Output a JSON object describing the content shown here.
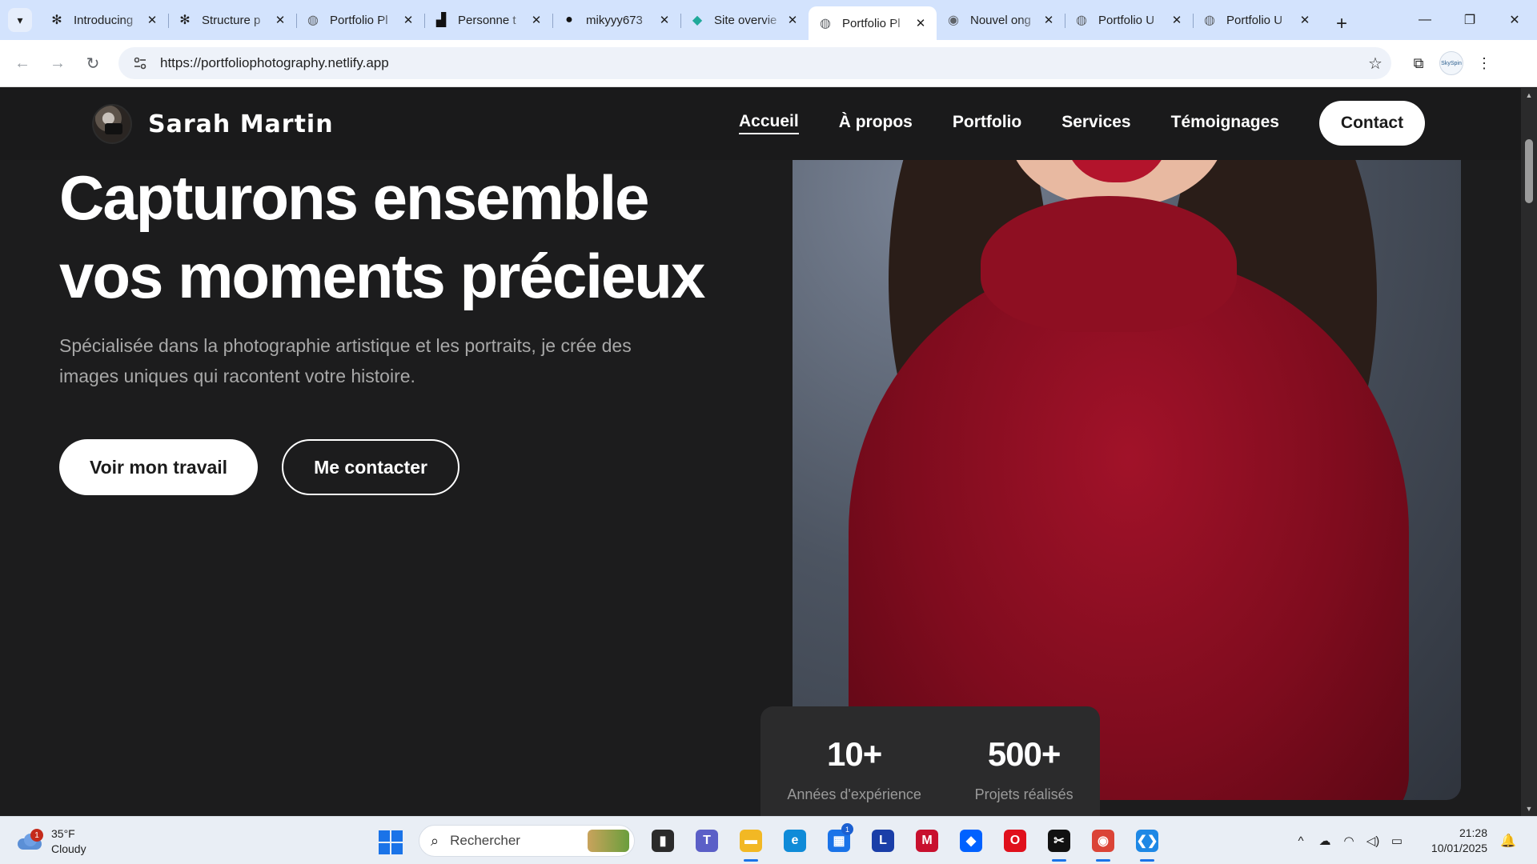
{
  "browser": {
    "tabs": [
      {
        "title": "Introducing",
        "favicon": "openai-icon",
        "active": false
      },
      {
        "title": "Structure p",
        "favicon": "openai-icon",
        "active": false
      },
      {
        "title": "Portfolio Pl",
        "favicon": "globe-icon",
        "active": false
      },
      {
        "title": "Personne t",
        "favicon": "unsplash-icon",
        "active": false
      },
      {
        "title": "mikyyy673",
        "favicon": "github-icon",
        "active": false
      },
      {
        "title": "Site overvie",
        "favicon": "netlify-icon",
        "active": false
      },
      {
        "title": "Portfolio Pl",
        "favicon": "globe-icon",
        "active": true
      },
      {
        "title": "Nouvel ong",
        "favicon": "chrome-icon",
        "active": false
      },
      {
        "title": "Portfolio U",
        "favicon": "globe-icon",
        "active": false
      },
      {
        "title": "Portfolio U",
        "favicon": "globe-icon",
        "active": false
      }
    ],
    "url": "https://portfoliophotography.netlify.app",
    "profile_label": "SkySpin"
  },
  "site": {
    "brand": "Sarah Martin",
    "nav": [
      "Accueil",
      "À propos",
      "Portfolio",
      "Services",
      "Témoignages"
    ],
    "nav_active": "Accueil",
    "contact_label": "Contact",
    "hero": {
      "title": "Capturons ensemble vos moments précieux",
      "subtitle": "Spécialisée dans la photographie artistique et les portraits, je crée des images uniques qui racontent votre histoire.",
      "primary_button": "Voir mon travail",
      "secondary_button": "Me contacter"
    },
    "stats": [
      {
        "value": "10+",
        "label": "Années d'expérience"
      },
      {
        "value": "500+",
        "label": "Projets réalisés"
      }
    ]
  },
  "taskbar": {
    "weather": {
      "temp": "35°F",
      "condition": "Cloudy",
      "badge": "1"
    },
    "search_placeholder": "Rechercher",
    "apps": [
      {
        "name": "task-view",
        "color": "#2b2b2b",
        "glyph": "▮",
        "running": false
      },
      {
        "name": "teams",
        "color": "#5b5fc7",
        "glyph": "T",
        "running": false
      },
      {
        "name": "file-explorer",
        "color": "#f2b824",
        "glyph": "▬",
        "running": true
      },
      {
        "name": "edge",
        "color": "#0f8bd8",
        "glyph": "e",
        "running": false
      },
      {
        "name": "microsoft-store",
        "color": "#1a73e8",
        "glyph": "▦",
        "running": false,
        "badge": "1"
      },
      {
        "name": "l-app",
        "color": "#1a3ea8",
        "glyph": "L",
        "running": false
      },
      {
        "name": "mcafee",
        "color": "#c8102e",
        "glyph": "M",
        "running": false
      },
      {
        "name": "dropbox",
        "color": "#0061ff",
        "glyph": "◆",
        "running": false
      },
      {
        "name": "opera",
        "color": "#e0101c",
        "glyph": "O",
        "running": false
      },
      {
        "name": "capcut",
        "color": "#111111",
        "glyph": "✂",
        "running": true
      },
      {
        "name": "chrome",
        "color": "#db4437",
        "glyph": "◉",
        "running": true
      },
      {
        "name": "vscode",
        "color": "#1e88e5",
        "glyph": "❮❯",
        "running": true
      }
    ],
    "time": "21:28",
    "date": "10/01/2025"
  }
}
